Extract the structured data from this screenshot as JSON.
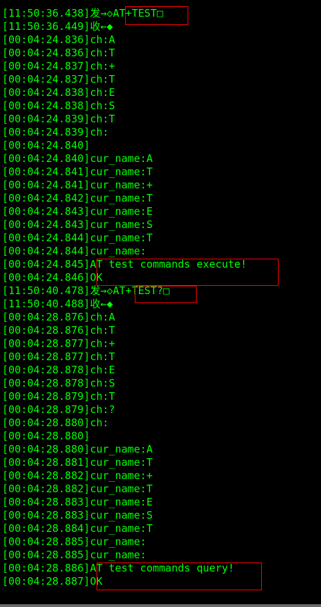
{
  "log": [
    {
      "ts": "[11:50:36.438]",
      "msg": "发→◇AT+TEST□"
    },
    {
      "ts": "[11:50:36.449]",
      "msg": "收←◆"
    },
    {
      "ts": "[00:04:24.836]",
      "msg": "ch:A"
    },
    {
      "ts": "[00:04:24.836]",
      "msg": "ch:T"
    },
    {
      "ts": "[00:04:24.837]",
      "msg": "ch:+"
    },
    {
      "ts": "[00:04:24.837]",
      "msg": "ch:T"
    },
    {
      "ts": "[00:04:24.838]",
      "msg": "ch:E"
    },
    {
      "ts": "[00:04:24.838]",
      "msg": "ch:S"
    },
    {
      "ts": "[00:04:24.839]",
      "msg": "ch:T"
    },
    {
      "ts": "[00:04:24.839]",
      "msg": "ch:"
    },
    {
      "ts": "[00:04:24.840]",
      "msg": ""
    },
    {
      "ts": "[00:04:24.840]",
      "msg": "cur_name:A"
    },
    {
      "ts": "[00:04:24.841]",
      "msg": "cur_name:T"
    },
    {
      "ts": "[00:04:24.841]",
      "msg": "cur_name:+"
    },
    {
      "ts": "[00:04:24.842]",
      "msg": "cur_name:T"
    },
    {
      "ts": "[00:04:24.843]",
      "msg": "cur_name:E"
    },
    {
      "ts": "[00:04:24.843]",
      "msg": "cur_name:S"
    },
    {
      "ts": "[00:04:24.844]",
      "msg": "cur_name:T"
    },
    {
      "ts": "[00:04:24.844]",
      "msg": "cur_name:"
    },
    {
      "ts": "[00:04:24.845]",
      "msg": "AT test commands execute!"
    },
    {
      "ts": "[00:04:24.846]",
      "msg": "OK"
    },
    {
      "ts": "[11:50:40.478]",
      "msg": "发→◇AT+TEST?□"
    },
    {
      "ts": "[11:50:40.488]",
      "msg": "收←◆"
    },
    {
      "ts": "[00:04:28.876]",
      "msg": "ch:A"
    },
    {
      "ts": "[00:04:28.876]",
      "msg": "ch:T"
    },
    {
      "ts": "[00:04:28.877]",
      "msg": "ch:+"
    },
    {
      "ts": "[00:04:28.877]",
      "msg": "ch:T"
    },
    {
      "ts": "[00:04:28.878]",
      "msg": "ch:E"
    },
    {
      "ts": "[00:04:28.878]",
      "msg": "ch:S"
    },
    {
      "ts": "[00:04:28.879]",
      "msg": "ch:T"
    },
    {
      "ts": "[00:04:28.879]",
      "msg": "ch:?"
    },
    {
      "ts": "[00:04:28.880]",
      "msg": "ch:"
    },
    {
      "ts": "[00:04:28.880]",
      "msg": ""
    },
    {
      "ts": "[00:04:28.880]",
      "msg": "cur_name:A"
    },
    {
      "ts": "[00:04:28.881]",
      "msg": "cur_name:T"
    },
    {
      "ts": "[00:04:28.882]",
      "msg": "cur_name:+"
    },
    {
      "ts": "[00:04:28.882]",
      "msg": "cur_name:T"
    },
    {
      "ts": "[00:04:28.883]",
      "msg": "cur_name:E"
    },
    {
      "ts": "[00:04:28.883]",
      "msg": "cur_name:S"
    },
    {
      "ts": "[00:04:28.884]",
      "msg": "cur_name:T"
    },
    {
      "ts": "[00:04:28.885]",
      "msg": "cur_name:"
    },
    {
      "ts": "[00:04:28.885]",
      "msg": "cur_name:"
    },
    {
      "ts": "[00:04:28.886]",
      "msg": "AT test commands query!"
    },
    {
      "ts": "[00:04:28.887]",
      "msg": "OK"
    }
  ],
  "colors": {
    "text": "#00ff00",
    "background": "#000000",
    "highlight_border": "#ff0000"
  }
}
